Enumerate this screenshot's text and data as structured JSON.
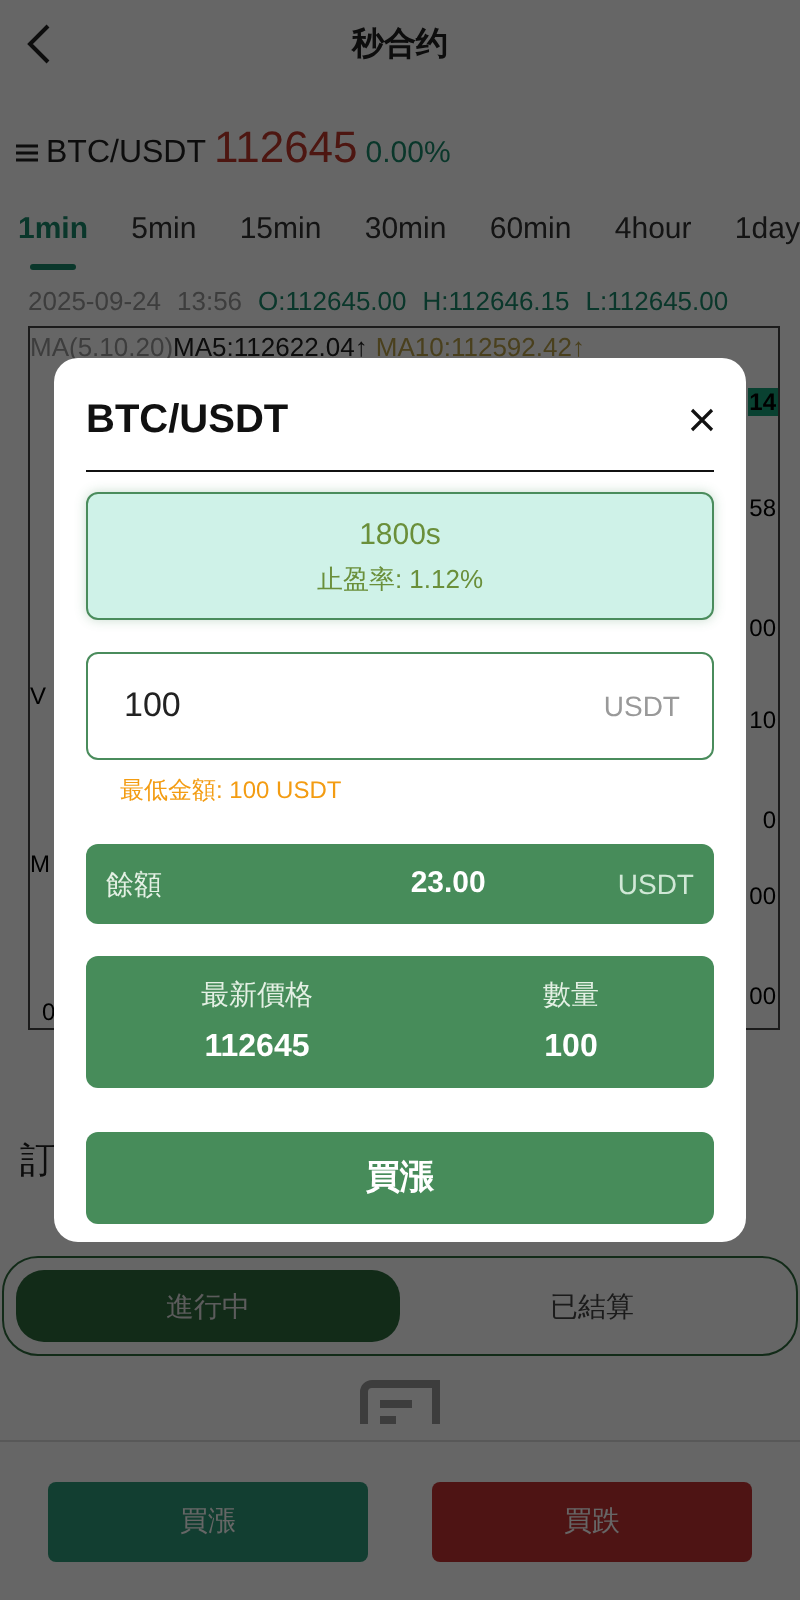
{
  "header": {
    "title": "秒合约"
  },
  "symbol": {
    "pair": "BTC/USDT",
    "price": "112645",
    "change": "0.00%"
  },
  "intervals": [
    {
      "label": "1min",
      "selected": true
    },
    {
      "label": "5min",
      "selected": false
    },
    {
      "label": "15min",
      "selected": false
    },
    {
      "label": "30min",
      "selected": false
    },
    {
      "label": "60min",
      "selected": false
    },
    {
      "label": "4hour",
      "selected": false
    },
    {
      "label": "1day",
      "selected": false
    }
  ],
  "ohlc": {
    "date": "2025-09-24",
    "time": "13:56",
    "open": "O:112645.00",
    "high": "H:112646.15",
    "low": "L:112645.00"
  },
  "chart": {
    "ma_label": "MA(5.10.20)",
    "ma5": "MA5:112622.04↑",
    "ma10": "MA10:112592.42↑",
    "price_tag": "14",
    "axis_labels": [
      "58",
      "00",
      "10",
      "0",
      "00",
      "00"
    ],
    "volume_label": "V",
    "macd_label": "M",
    "x_label": "0"
  },
  "orders": {
    "title": "訂",
    "tabs": [
      {
        "label": "進行中",
        "selected": true
      },
      {
        "label": "已結算",
        "selected": false
      }
    ]
  },
  "bottom_buttons": [
    {
      "label": "買漲",
      "kind": "up"
    },
    {
      "label": "買跌",
      "kind": "down"
    }
  ],
  "modal": {
    "title": "BTC/USDT",
    "options": [
      {
        "duration": "1800s",
        "rate": "止盈率: 1.12%",
        "selected": true
      }
    ],
    "amount": {
      "value": "100",
      "unit": "USDT"
    },
    "hint": "最低金額: 100 USDT",
    "balance": {
      "label": "餘額",
      "value": "23.00",
      "unit": "USDT"
    },
    "stats": [
      {
        "label": "最新價格",
        "value": "112645"
      },
      {
        "label": "數量",
        "value": "100"
      }
    ],
    "submit": "買漲"
  }
}
